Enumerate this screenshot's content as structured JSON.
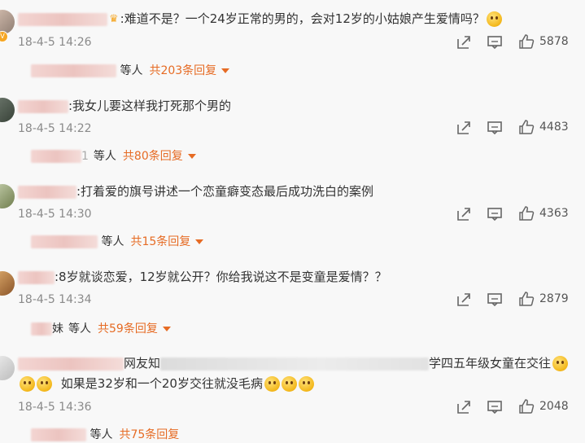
{
  "comments": [
    {
      "text": ":难道不是？一个24岁正常的男的，会对12岁的小姑娘产生爱情吗？",
      "time": "18-4-5 14:26",
      "likes": "5878",
      "replies": {
        "who": "等人",
        "link": "共203条回复"
      }
    },
    {
      "text": ":我女儿要这样我打死那个男的",
      "time": "18-4-5 14:22",
      "likes": "4483",
      "replies": {
        "who_prefix": "1",
        "who": "等人",
        "link": "共80条回复"
      }
    },
    {
      "text": ":打着爱的旗号讲述一个恋童癖变态最后成功洗白的案例",
      "time": "18-4-5 14:30",
      "likes": "4363",
      "replies": {
        "who": "等人",
        "link": "共15条回复"
      }
    },
    {
      "name_suffix": "妹",
      "text": ":8岁就谈恋爱，12岁就公开？你给我说这不是变童是爱情？？",
      "time": "18-4-5 14:34",
      "likes": "2879",
      "replies": {
        "who_prefix": "妹",
        "who": "等人",
        "link": "共59条回复"
      }
    },
    {
      "text_a": "网友知",
      "text_b": "学四五年级女童在交往",
      "text_line2": "如果是32岁和一个20岁交往就没毛病",
      "time": "18-4-5 14:36",
      "likes": "2048",
      "replies": {
        "who": "等人",
        "link": "共75条回复"
      }
    }
  ],
  "icons": {
    "share": "share-icon",
    "comment": "comment-icon",
    "like": "thumbs-up-icon"
  },
  "colors": {
    "accent": "#e66b24",
    "meta": "#8a8a8a"
  }
}
